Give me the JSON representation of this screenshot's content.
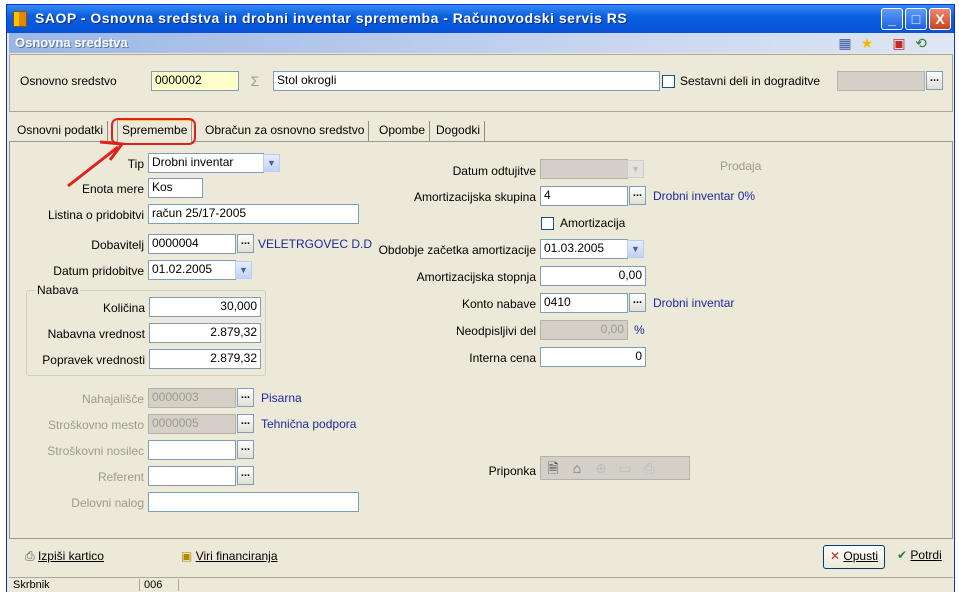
{
  "window": {
    "title": "SAOP -  Osnovna sredstva in drobni inventar sprememba - Računovodski servis RS",
    "min": "_",
    "max": "□",
    "close": "X"
  },
  "subheader": {
    "title": "Osnovna sredstva"
  },
  "top": {
    "os_label": "Osnovno sredstvo",
    "os_code": "0000002",
    "os_name": "Stol okrogli",
    "sestavni_label": "Sestavni deli in dograditve",
    "sestavni_value": "",
    "dots": "..."
  },
  "tabs": [
    {
      "label": "Osnovni podatki"
    },
    {
      "label": "Spremembe"
    },
    {
      "label": "Obračun za osnovno sredstvo"
    },
    {
      "label": "Opombe"
    },
    {
      "label": "Dogodki"
    }
  ],
  "left": {
    "tip_label": "Tip",
    "tip_value": "Drobni inventar",
    "enota_label": "Enota mere",
    "enota_value": "Kos",
    "listina_label": "Listina o pridobitvi",
    "listina_value": "račun 25/17-2005",
    "dobavitelj_label": "Dobavitelj",
    "dobavitelj_code": "0000004",
    "dobavitelj_name": "VELETRGOVEC D.D",
    "datum_label": "Datum pridobitve",
    "datum_value": "01.02.2005",
    "nabava_title": "Nabava",
    "kolicina_label": "Količina",
    "kolicina_value": "30,000",
    "nabavna_label": "Nabavna vrednost",
    "nabavna_value": "2.879,32",
    "popravek_label": "Popravek vrednosti",
    "popravek_value": "2.879,32",
    "nahajalisce_label": "Nahajališče",
    "nahajalisce_code": "0000003",
    "nahajalisce_name": "Pisarna",
    "strmesto_label": "Stroškovno mesto",
    "strmesto_code": "0000005",
    "strmesto_name": "Tehnična podpora",
    "strnosilec_label": "Stroškovni nosilec",
    "referent_label": "Referent",
    "delovni_label": "Delovni nalog"
  },
  "right": {
    "odtujitve_label": "Datum odtujitve",
    "prodaja_label": "Prodaja",
    "amskupina_label": "Amortizacijska skupina",
    "amskupina_value": "4",
    "amskupina_name": "Drobni inventar 0%",
    "amortizacija_label": "Amortizacija",
    "obdobje_label": "Obdobje začetka amortizacije",
    "obdobje_value": "01.03.2005",
    "stopnja_label": "Amortizacijska stopnja",
    "stopnja_value": "0,00",
    "konto_label": "Konto nabave",
    "konto_value": "0410",
    "konto_name": "Drobni inventar",
    "neodpis_label": "Neodpisljivi del",
    "neodpis_value": "0,00",
    "neodpis_unit": "%",
    "interna_label": "Interna cena",
    "interna_value": "0",
    "priponka_label": "Priponka"
  },
  "bottom": {
    "izpisi": "Izpiši kartico",
    "viri": "Viri financiranja",
    "opusti": "Opusti",
    "potrdi": "Potrdi"
  },
  "status": {
    "user": "Skrbnik",
    "code": "006"
  },
  "colors": {
    "titlebar": "#0752d8",
    "annotation": "#e0211a",
    "link": "#1c2a9e"
  }
}
